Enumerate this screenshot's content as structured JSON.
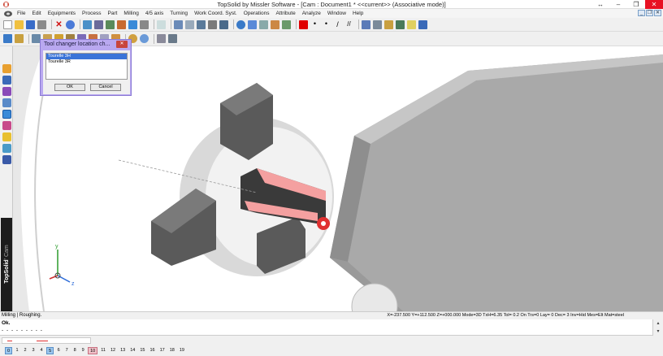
{
  "window": {
    "title": "TopSolid by Missler Software - [Cam : Document1 *  <<current>> (Associative mode)]",
    "buttons": {
      "restore": "↔",
      "minimize": "–",
      "maximize": "❐",
      "close": "✕"
    }
  },
  "menu": {
    "items": [
      "File",
      "Edit",
      "Equipments",
      "Process",
      "Part",
      "Milling",
      "4/5 axis",
      "Turning",
      "Work Coord. Syst.",
      "Operations",
      "Attribute",
      "Analyze",
      "Window",
      "Help"
    ],
    "mdi_buttons": [
      "_",
      "❐",
      "✕"
    ]
  },
  "brand": {
    "name": "TopSolid",
    "module": "' Cam"
  },
  "dialog": {
    "title": "Tool changer location ch...",
    "close": "✕",
    "options": [
      "Tourelle  3H",
      "Tourelle  3R"
    ],
    "selected_index": 0,
    "ok_label": "OK",
    "cancel_label": "Cancel"
  },
  "viewport": {
    "axis_labels": {
      "y": "y",
      "z": "z",
      "x": "x"
    },
    "colors": {
      "highlight": "#e03030",
      "cutaway": "#f4a0a0"
    }
  },
  "status": {
    "left": "Milling | Roughing.",
    "right": "X=-237.500  Y=+112.500  Z=+000.000  Mode=3D  TxH=6.35   Tol=  0.2    On  Trs=0    Lay=  0   Dec= 3    Inv=Hid  Mes=Elt  Mat=steel"
  },
  "prompt": {
    "line1": "Ok.",
    "line2": "- - - - - - - - -",
    "scroll_up": "▴",
    "scroll_down": "▾"
  },
  "pages": {
    "items": [
      "0",
      "1",
      "2",
      "3",
      "4",
      "5",
      "6",
      "7",
      "8",
      "9",
      "10",
      "11",
      "12",
      "13",
      "14",
      "15",
      "16",
      "17",
      "18",
      "19"
    ],
    "highlighted": [
      "0",
      "5"
    ],
    "active": "10"
  }
}
